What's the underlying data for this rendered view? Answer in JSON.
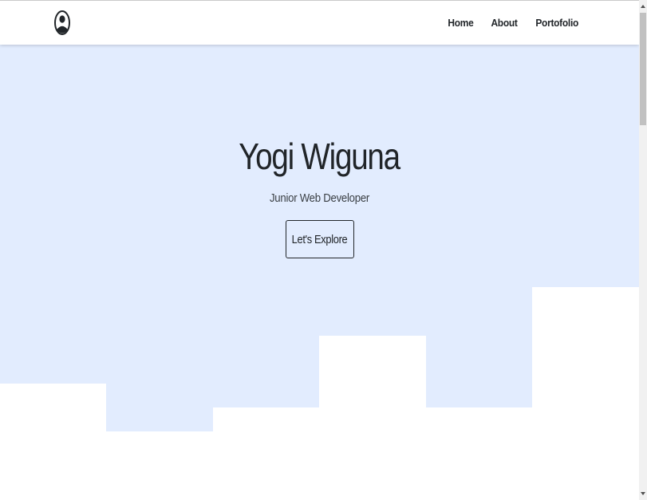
{
  "colors": {
    "hero_bg": "#e2ecfe",
    "text": "#212529",
    "navbar_bg": "#ffffff"
  },
  "navbar": {
    "logo_icon": "user-avatar-icon",
    "links": [
      {
        "label": "Home"
      },
      {
        "label": "About"
      },
      {
        "label": "Portofolio"
      }
    ]
  },
  "hero": {
    "title": "Yogi Wiguna",
    "subtitle": "Junior Web Developer",
    "cta_label": "Let's Explore"
  }
}
